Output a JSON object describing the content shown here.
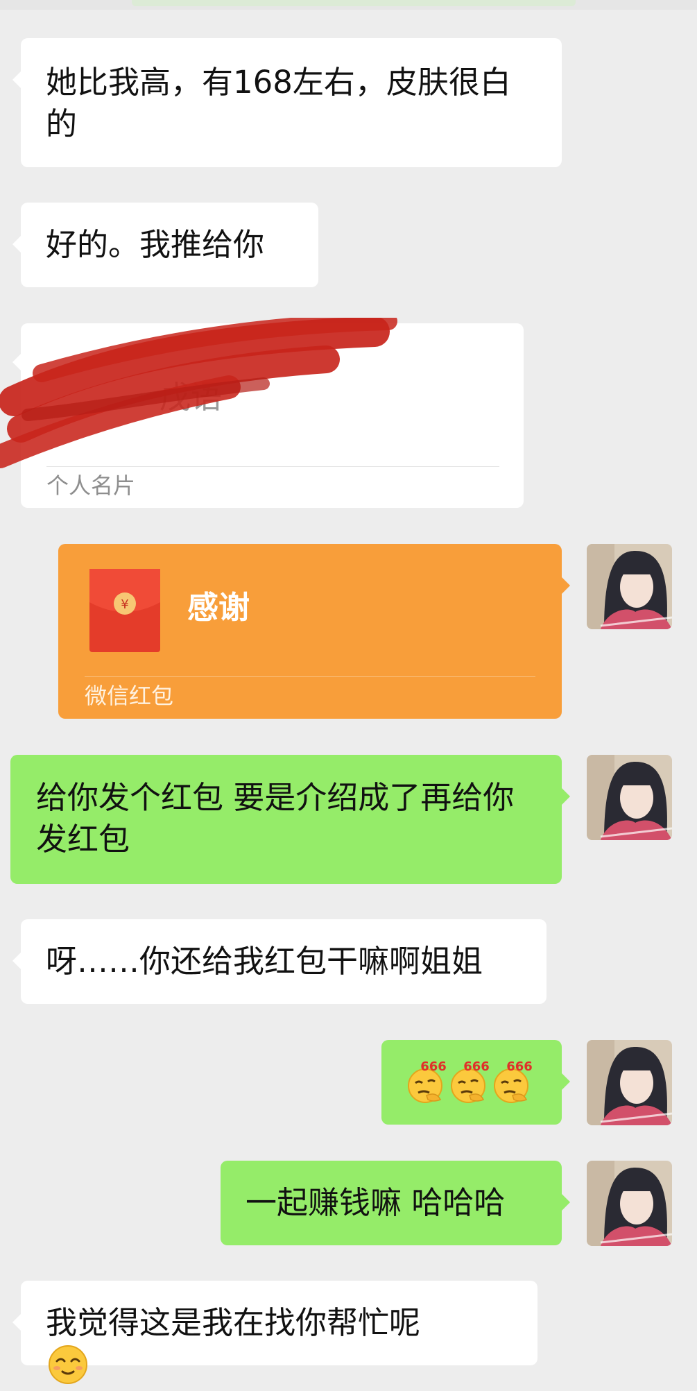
{
  "messages": {
    "m1": {
      "text": "她比我高，有168左右，皮肤很白的"
    },
    "m2": {
      "text": "好的。我推给你"
    },
    "card": {
      "name": "戊语",
      "footer": "个人名片"
    },
    "redpacket": {
      "title": "感谢",
      "footer": "微信红包",
      "symbol": "¥"
    },
    "m4": {
      "text": "给你发个红包 要是介绍成了再给你发红包"
    },
    "m5": {
      "text": "呀……你还给我红包干嘛啊姐姐"
    },
    "m6": {
      "emoji_text": "666",
      "emoji_count": 3
    },
    "m7": {
      "text": "一起赚钱嘛 哈哈哈"
    },
    "m8": {
      "text": "我觉得这是我在找你帮忙呢"
    }
  },
  "colors": {
    "background": "#ededed",
    "incoming_bubble": "#ffffff",
    "outgoing_bubble": "#95ec69",
    "red_packet": "#f89e3a",
    "scribble": "#c8241b"
  }
}
